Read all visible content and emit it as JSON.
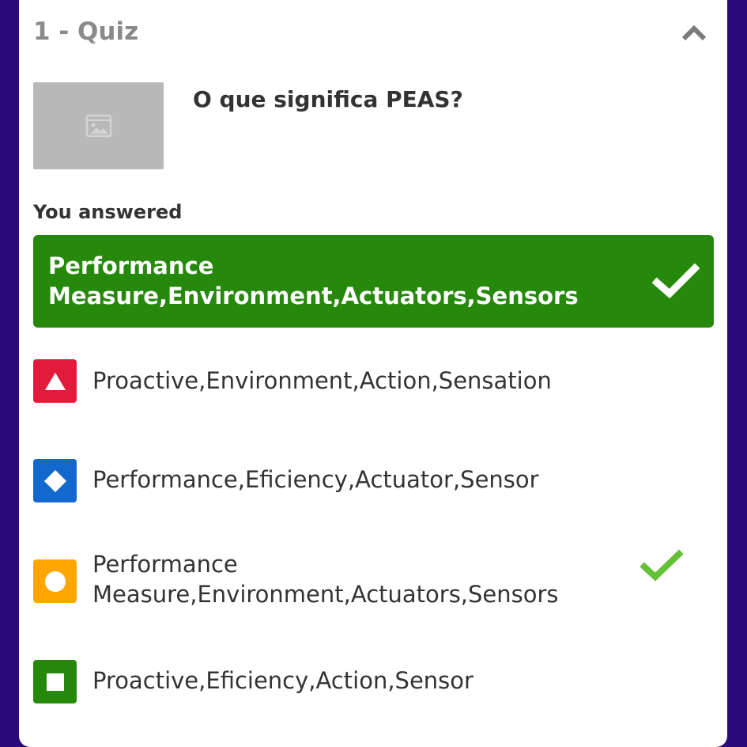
{
  "quiz": {
    "title": "1 - Quiz",
    "question": "O que significa PEAS?",
    "answered_label": "You answered",
    "answered_text": "Performance Measure,Environment,Actuators,Sensors",
    "answered_correct": true
  },
  "options": [
    {
      "text": "Proactive,Environment,Action,Sensation",
      "shape": "triangle",
      "color": "#e21b3c",
      "correct": false
    },
    {
      "text": "Performance,Eficiency,Actuator,Sensor",
      "shape": "diamond",
      "color": "#1368ce",
      "correct": false
    },
    {
      "text": "Performance Measure,Environment,Actuators,Sensors",
      "shape": "circle",
      "color": "#ffa602",
      "correct": true
    },
    {
      "text": "Proactive,Eficiency,Action,Sensor",
      "shape": "square",
      "color": "#26890c",
      "correct": false
    }
  ],
  "colors": {
    "background": "#2a0a7a",
    "answered_bg": "#26890c",
    "check_green": "#66bf39"
  }
}
